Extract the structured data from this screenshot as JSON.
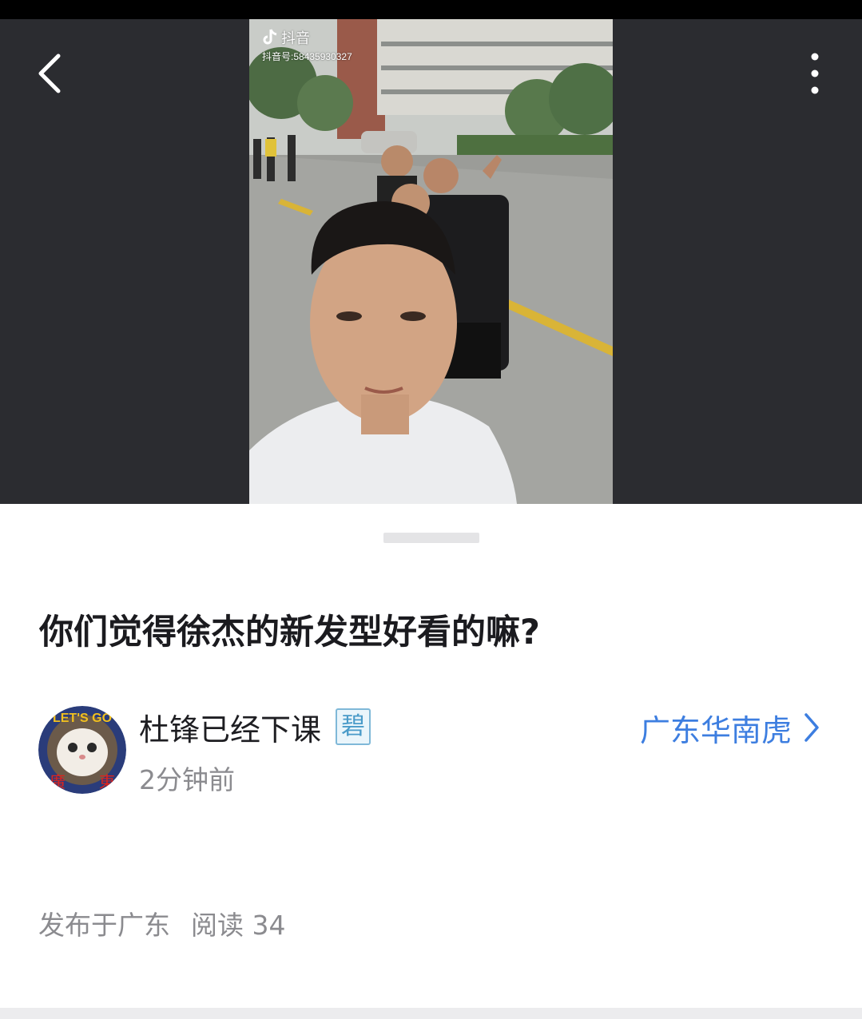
{
  "header": {
    "back_icon": "chevron-left-icon",
    "more_icon": "more-vertical-icon"
  },
  "media": {
    "watermark_app": "抖音",
    "watermark_id": "抖音号:58435930327"
  },
  "post": {
    "title": "你们觉得徐杰的新发型好看的嘛?",
    "author_name": "杜锋已经下课",
    "author_badge": "碧",
    "time": "2分钟前",
    "forum_name": "广东华南虎",
    "published_location": "发布于广东",
    "read_count": "阅读 34"
  },
  "colors": {
    "accent": "#3d7ee0",
    "media_bg": "#2b2c30",
    "muted_text": "#8b8b8f"
  }
}
